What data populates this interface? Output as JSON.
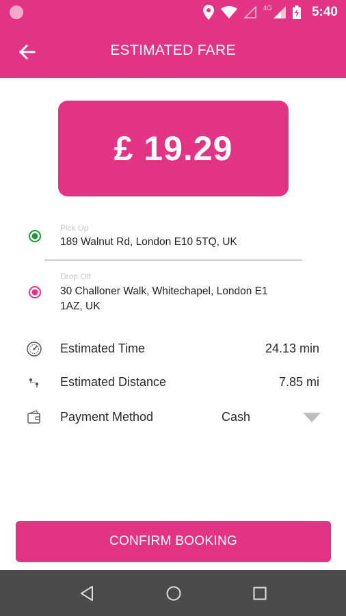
{
  "status_bar": {
    "time": "5:40",
    "network": "4G",
    "icons": [
      "notification-dot-icon",
      "location-icon",
      "wifi-icon",
      "signal-empty-icon",
      "signal-icon",
      "battery-icon"
    ]
  },
  "app_bar": {
    "title": "ESTIMATED FARE",
    "back_icon": "arrow-left-icon"
  },
  "fare": {
    "amount": "£ 19.29"
  },
  "pickup": {
    "caption": "Pick Up",
    "address": "189 Walnut Rd, London E10 5TQ, UK",
    "color": "#1e9a3b"
  },
  "dropoff": {
    "caption": "Drop Off",
    "address_line1": "30 Challoner Walk, Whitechapel, London E1",
    "address_line2": "1AZ, UK",
    "color": "#e23384"
  },
  "details": {
    "time": {
      "label": "Estimated Time",
      "value": "24.13 min",
      "icon": "speedometer-icon"
    },
    "distance": {
      "label": "Estimated Distance",
      "value": "7.85 mi",
      "icon": "route-pins-icon"
    },
    "payment": {
      "label": "Payment Method",
      "value": "Cash",
      "icon": "wallet-icon"
    }
  },
  "confirm": {
    "label": "CONFIRM BOOKING"
  },
  "nav": {
    "icons": [
      "back-triangle-icon",
      "home-circle-icon",
      "recents-square-icon"
    ]
  },
  "colors": {
    "primary": "#e23384",
    "nav_bar": "#4b4b4b"
  }
}
